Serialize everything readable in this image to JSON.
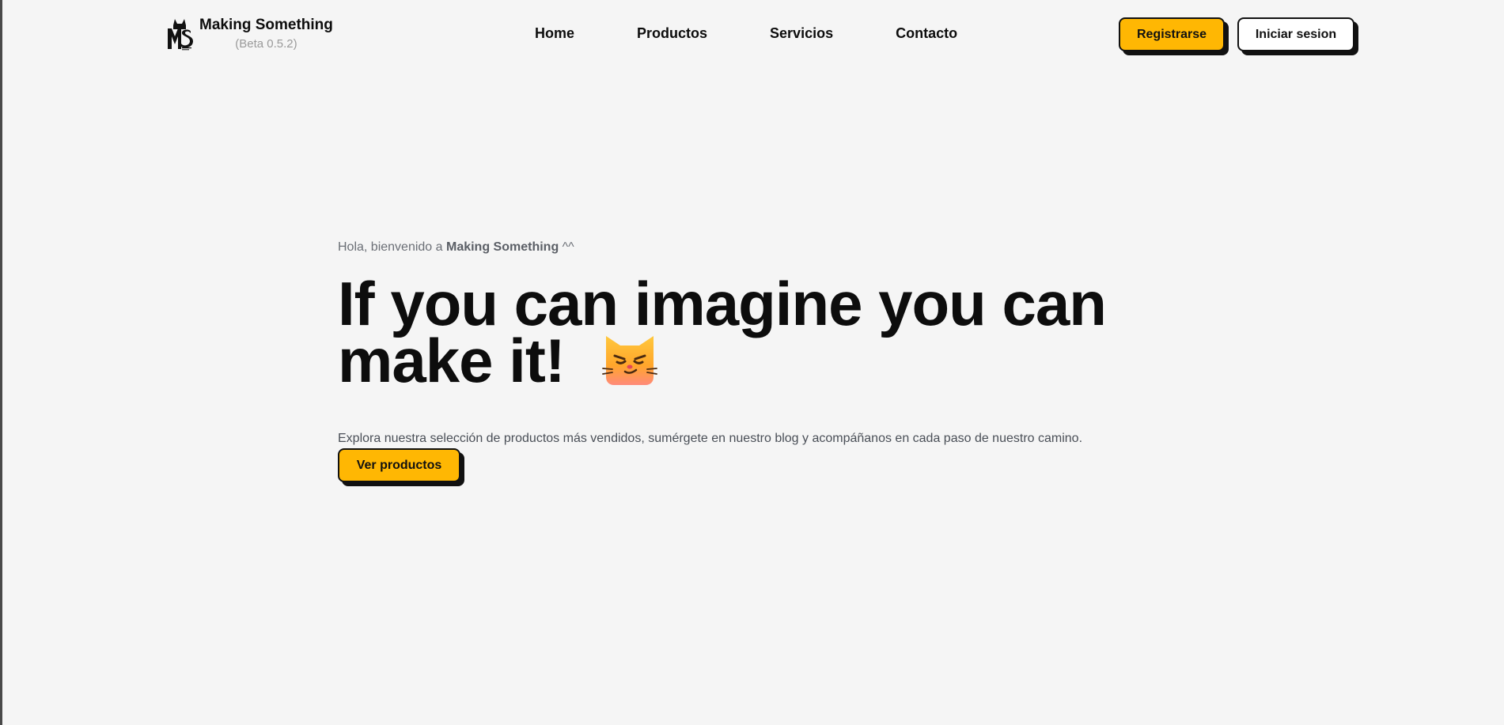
{
  "brand": {
    "name": "Making Something",
    "version": "(Beta 0.5.2)",
    "logo_text": "MS",
    "logo_icon": "cat-logo-icon"
  },
  "nav": {
    "items": [
      {
        "label": "Home"
      },
      {
        "label": "Productos"
      },
      {
        "label": "Servicios"
      },
      {
        "label": "Contacto"
      }
    ]
  },
  "auth": {
    "register_label": "Registrarse",
    "login_label": "Iniciar sesion"
  },
  "hero": {
    "greeting_prefix": "Hola, bienvenido a ",
    "greeting_brand": "Making Something",
    "greeting_suffix": " ^^",
    "headline_line1": "If you can imagine you can",
    "headline_line2": "make it!",
    "emoji_icon": "smirking-cat-icon",
    "description": "Explora nuestra selección de productos más vendidos, sumérgete en nuestro blog y acompáñanos en cada paso de nuestro camino.",
    "cta_label": "Ver productos"
  },
  "colors": {
    "background": "#f5f5f5",
    "accent": "#ffb703",
    "text": "#0d0d0d",
    "muted": "#6b6f76"
  }
}
